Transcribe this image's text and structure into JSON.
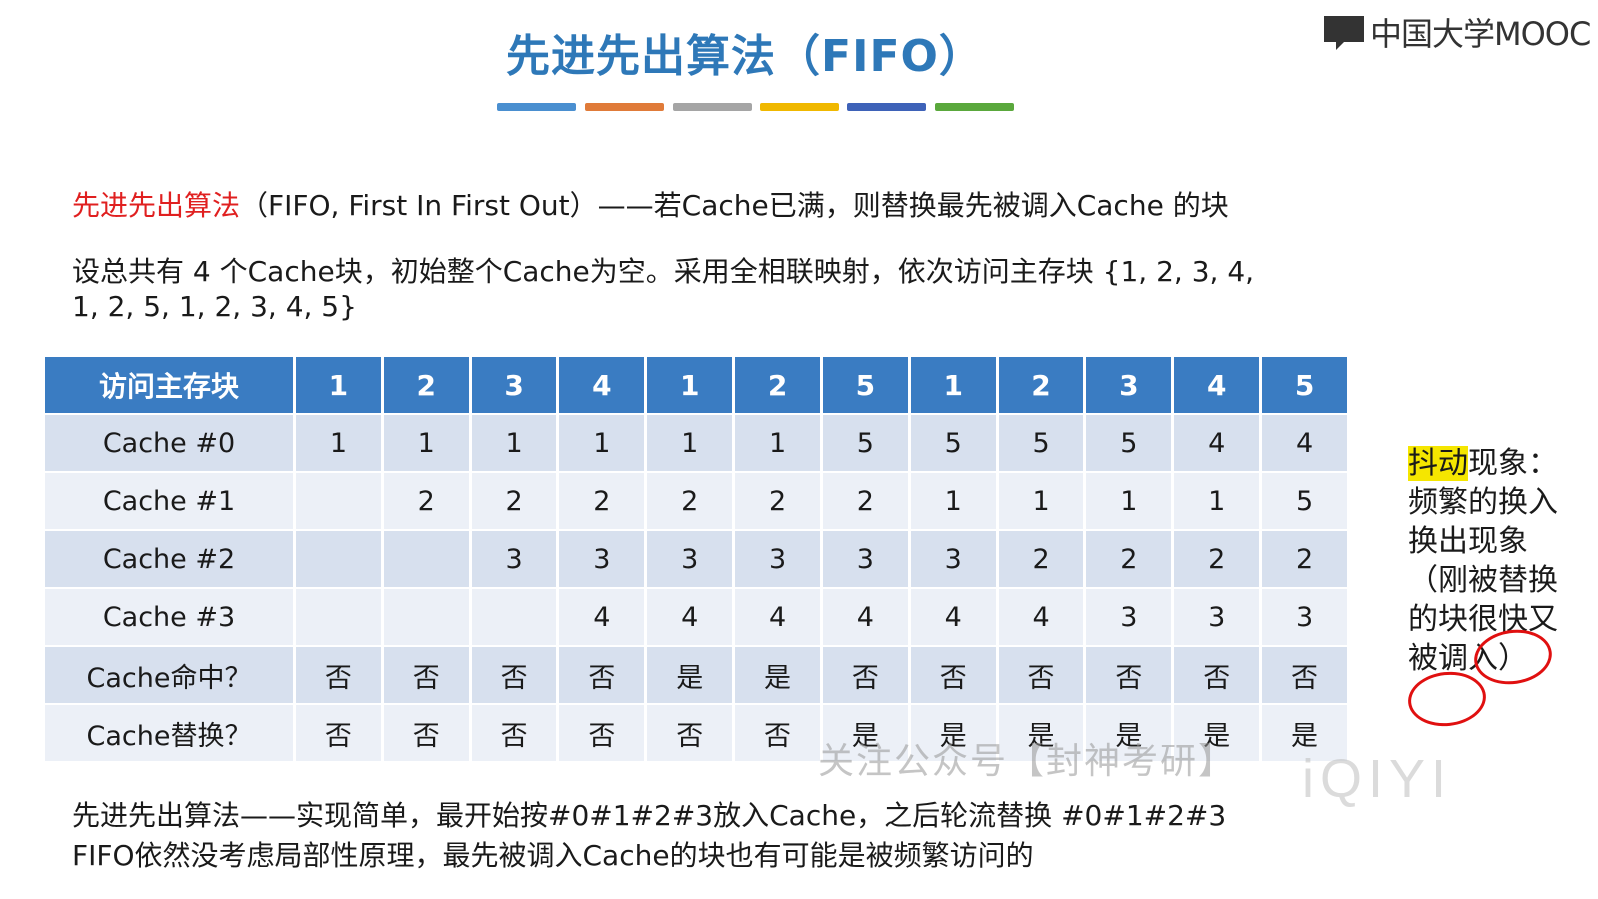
{
  "logo": {
    "text": "中国大学MOOC"
  },
  "title": "先进先出算法（FIFO）",
  "title_bar_colors": [
    "#4a8fd0",
    "#e07b39",
    "#a5a5a5",
    "#f0b800",
    "#3e62b8",
    "#5aa83c"
  ],
  "intro": {
    "algo_name": "先进先出算法",
    "rest": "（FIFO, First In First Out）——若Cache已满，则替换最先被调入Cache 的块"
  },
  "problem": {
    "line1": "设总共有 4 个Cache块，初始整个Cache为空。采用全相联映射，依次访问主存块 {1, 2, 3, 4,",
    "line2": "1, 2, 5, 1, 2, 3, 4, 5}"
  },
  "table": {
    "header_label": "访问主存块",
    "accesses": [
      "1",
      "2",
      "3",
      "4",
      "1",
      "2",
      "5",
      "1",
      "2",
      "3",
      "4",
      "5"
    ],
    "rows": [
      {
        "label": "Cache #0",
        "cells": [
          {
            "v": "1",
            "c": "red"
          },
          {
            "v": "1"
          },
          {
            "v": "1"
          },
          {
            "v": "1"
          },
          {
            "v": "1",
            "c": "green"
          },
          {
            "v": "1"
          },
          {
            "v": "5",
            "c": "red"
          },
          {
            "v": "5"
          },
          {
            "v": "5"
          },
          {
            "v": "5"
          },
          {
            "v": "4",
            "c": "red"
          },
          {
            "v": "4"
          }
        ]
      },
      {
        "label": "Cache #1",
        "cells": [
          {
            "v": ""
          },
          {
            "v": "2",
            "c": "red"
          },
          {
            "v": "2"
          },
          {
            "v": "2"
          },
          {
            "v": "2"
          },
          {
            "v": "2",
            "c": "green"
          },
          {
            "v": "2"
          },
          {
            "v": "1",
            "c": "red"
          },
          {
            "v": "1"
          },
          {
            "v": "1"
          },
          {
            "v": "1"
          },
          {
            "v": "5",
            "c": "red"
          }
        ]
      },
      {
        "label": "Cache #2",
        "cells": [
          {
            "v": ""
          },
          {
            "v": ""
          },
          {
            "v": "3",
            "c": "red"
          },
          {
            "v": "3"
          },
          {
            "v": "3"
          },
          {
            "v": "3"
          },
          {
            "v": "3"
          },
          {
            "v": "3"
          },
          {
            "v": "2",
            "c": "red"
          },
          {
            "v": "2"
          },
          {
            "v": "2"
          },
          {
            "v": "2"
          }
        ]
      },
      {
        "label": "Cache #3",
        "cells": [
          {
            "v": ""
          },
          {
            "v": ""
          },
          {
            "v": ""
          },
          {
            "v": "4",
            "c": "red"
          },
          {
            "v": "4"
          },
          {
            "v": "4"
          },
          {
            "v": "4"
          },
          {
            "v": "4"
          },
          {
            "v": "4"
          },
          {
            "v": "3",
            "c": "red"
          },
          {
            "v": "3"
          },
          {
            "v": "3"
          }
        ]
      },
      {
        "label": "Cache命中？",
        "cells": [
          {
            "v": "否"
          },
          {
            "v": "否"
          },
          {
            "v": "否"
          },
          {
            "v": "否"
          },
          {
            "v": "是"
          },
          {
            "v": "是"
          },
          {
            "v": "否"
          },
          {
            "v": "否"
          },
          {
            "v": "否"
          },
          {
            "v": "否"
          },
          {
            "v": "否"
          },
          {
            "v": "否"
          }
        ]
      },
      {
        "label": "Cache替换？",
        "cells": [
          {
            "v": "否"
          },
          {
            "v": "否"
          },
          {
            "v": "否"
          },
          {
            "v": "否"
          },
          {
            "v": "否"
          },
          {
            "v": "否"
          },
          {
            "v": "是"
          },
          {
            "v": "是"
          },
          {
            "v": "是"
          },
          {
            "v": "是"
          },
          {
            "v": "是"
          },
          {
            "v": "是"
          }
        ]
      }
    ]
  },
  "side_note": {
    "highlight": "抖动",
    "rest": "现象：频繁的换入换出现象（刚被替换的块很快又被调入）"
  },
  "watermark": "关注公众号【封神考研】",
  "watermark_brand": "iQIYI",
  "summary": {
    "line1": "先进先出算法——实现简单，最开始按#0#1#2#3放入Cache，之后轮流替换 #0#1#2#3",
    "line2": "FIFO依然没考虑局部性原理，最先被调入Cache的块也有可能是被频繁访问的"
  },
  "colors": {
    "title": "#2e78b8",
    "header_bg": "#3a7cc2",
    "row_dark": "#d7e0ee",
    "row_light": "#ecf0f7",
    "highlight_red": "#e02020",
    "highlight_green": "#2ca02c"
  }
}
